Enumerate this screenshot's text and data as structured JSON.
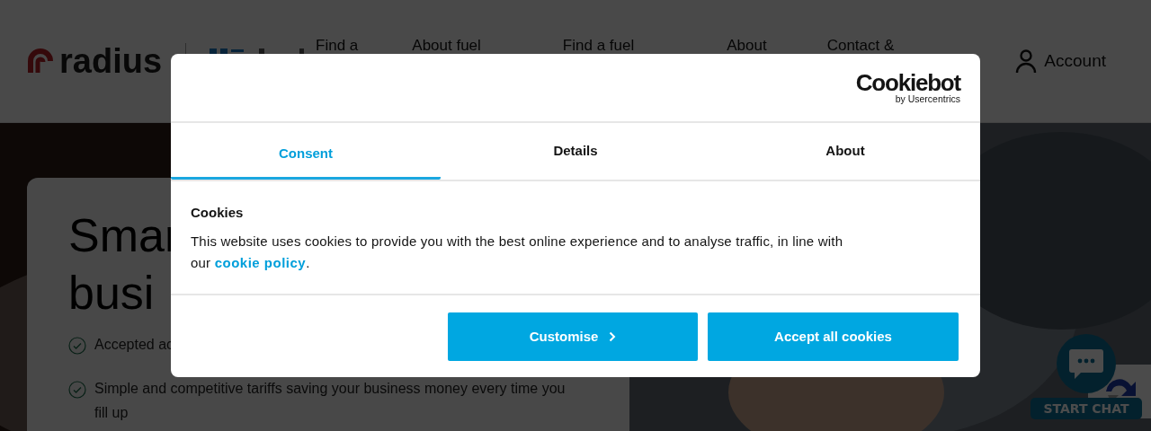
{
  "header": {
    "logo": "radius",
    "nav": [
      "Find a",
      "About fuel",
      "Find a fuel",
      "About",
      "Contact &"
    ],
    "account": "Account"
  },
  "hero": {
    "headline": [
      "Smar",
      "busi"
    ],
    "features": [
      "Accepted ac",
      "Simple and competitive tariffs saving your business money every time you fill up"
    ]
  },
  "chat": {
    "label": "START CHAT"
  },
  "consent_dialog": {
    "brand": "Cookiebot",
    "brand_sub": "by Usercentrics",
    "tabs": [
      {
        "label": "Consent",
        "selected": true
      },
      {
        "label": "Details",
        "selected": false
      },
      {
        "label": "About",
        "selected": false
      }
    ],
    "heading": "Cookies",
    "body": "This website uses cookies to provide you with the best online experience and to analyse traffic, in line with our ",
    "link": "cookie policy",
    "body_end": ".",
    "buttons": [
      {
        "label": "Customise",
        "kind": "customise"
      },
      {
        "label": "Accept all cookies",
        "kind": "accept"
      }
    ]
  }
}
